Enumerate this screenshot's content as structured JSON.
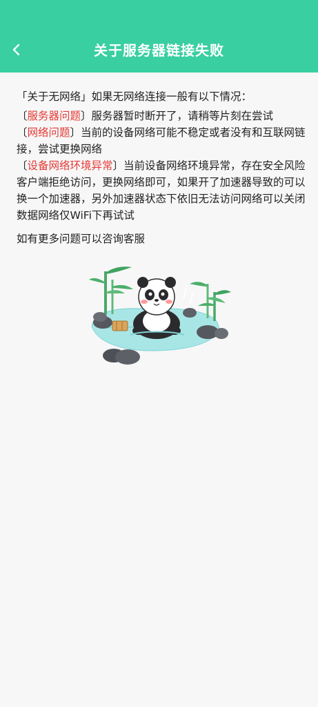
{
  "header": {
    "title": "关于服务器链接失败",
    "back_icon": "chevron-left-icon",
    "bg_color": "#39cfa0"
  },
  "intro": {
    "bracket_open": "「关于无网络」",
    "text": "如果无网络连接一般有以下情况："
  },
  "items": [
    {
      "open": "〔",
      "label": "服务器问题",
      "close": "〕",
      "text": "服务器暂时断开了，请稍等片刻在尝试"
    },
    {
      "open": "〔",
      "label": "网络问题",
      "close": "〕",
      "text": "当前的设备网络可能不稳定或者没有和互联网链接，尝试更换网络"
    },
    {
      "open": "〔",
      "label": "设备网络环境异常",
      "close": "〕",
      "text": "当前设备网络环境异常，存在安全风险客户端拒绝访问，更换网络即可，如果开了加速器导致的可以换一个加速器，另外加速器状态下依旧无法访问网络可以关闭数据网络仅WiFi下再试试"
    }
  ],
  "footer_text": "如有更多问题可以咨询客服",
  "illustration_icon": "panda-hot-spring-illustration",
  "accent_red": "#e53935"
}
